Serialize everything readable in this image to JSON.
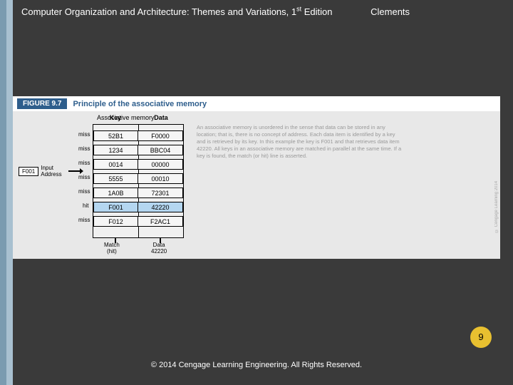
{
  "header": {
    "title_prefix": "Computer Organization and Architecture: Themes and Variations, 1",
    "title_sup": "st",
    "title_suffix": " Edition",
    "author": "Clements"
  },
  "figure": {
    "label": "FIGURE 9.7",
    "title": "Principle of the associative memory",
    "assoc_label": "Associative memory",
    "col_key": "Key",
    "col_data": "Data",
    "rows": [
      {
        "key": "52B1",
        "data": "F0000",
        "status": "miss"
      },
      {
        "key": "1234",
        "data": "BBC04",
        "status": "miss"
      },
      {
        "key": "0014",
        "data": "00000",
        "status": "miss"
      },
      {
        "key": "5555",
        "data": "00010",
        "status": "miss"
      },
      {
        "key": "1A0B",
        "data": "72301",
        "status": "miss"
      },
      {
        "key": "F001",
        "data": "42220",
        "status": "hit"
      },
      {
        "key": "F012",
        "data": "F2AC1",
        "status": "miss"
      }
    ],
    "input_value": "F001",
    "input_label_line1": "Input",
    "input_label_line2": "Address",
    "out_match_line1": "Match",
    "out_match_line2": "(hit)",
    "out_data_line1": "Data",
    "out_data_line2": "42220",
    "description": "An associative memory is unordered in the sense that data can be stored in any location; that is, there is no concept of address. Each data item is identified by a key and is retrieved by its key. In this example the key is F001 and that retrieves data item 42220. All keys in an associative memory are matched in parallel at the same time. If a key is found, the match (or hit) line is asserted.",
    "vert_credit": "© Cengage Learning 2014"
  },
  "page_number": "9",
  "copyright": "© 2014 Cengage Learning Engineering. All Rights Reserved."
}
